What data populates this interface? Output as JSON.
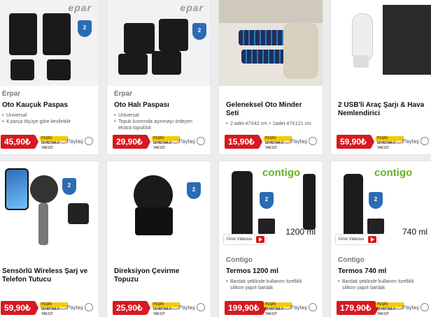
{
  "currency_note": "₺",
  "products": [
    {
      "brand_logo": "epar",
      "maker": "Erpar",
      "title": "Oto Kauçuk Paspas",
      "features": [
        "Universal",
        "4 parça ölçüye göre kesilebilir"
      ],
      "price": "45,90₺",
      "installment_top": "PEŞİN FİYATINA 6 TAKSİT",
      "installment_bottom": "bonus maximum",
      "share_label": "Paylaş",
      "guarantee": "2"
    },
    {
      "brand_logo": "epar",
      "maker": "Erpar",
      "title": "Oto Halı Paspası",
      "features": [
        "Universal",
        "Topuk kısmında aşınmayı önleyen ekstra topukluk"
      ],
      "price": "29,90₺",
      "installment_top": "PEŞİN FİYATINA 6 TAKSİT",
      "installment_bottom": "bonus maximum",
      "share_label": "Paylaş",
      "guarantee": "2"
    },
    {
      "maker": "",
      "title": "Geleneksel Oto Minder Seti",
      "features": [
        "2 adet 47X42 cm + 1adet 47X121 cm"
      ],
      "price": "15,90₺",
      "installment_top": "PEŞİN FİYATINA 6 TAKSİT",
      "installment_bottom": "bonus maximum",
      "share_label": "Paylaş"
    },
    {
      "maker": "",
      "title": "2 USB'li Araç Şarjı & Hava Nemlendirici",
      "features": [],
      "price": "59,90₺",
      "installment_top": "PEŞİN FİYATINA 6 TAKSİT",
      "installment_bottom": "bonus maximum",
      "share_label": "Paylaş"
    },
    {
      "maker": "",
      "title": "Sensörlü Wireless Şarj ve Telefon Tutucu",
      "features": [],
      "price": "59,90₺",
      "installment_top": "PEŞİN FİYATINA 6 TAKSİT",
      "installment_bottom": "bonus maximum",
      "share_label": "Paylaş",
      "guarantee": "2"
    },
    {
      "maker": "",
      "title": "Direksiyon Çevirme Topuzu",
      "features": [],
      "price": "25,90₺",
      "installment_top": "PEŞİN FİYATINA 6 TAKSİT",
      "installment_bottom": "bonus maximum",
      "share_label": "Paylaş",
      "guarantee": "2"
    },
    {
      "brand_logo": "contigo",
      "maker": "Contigo",
      "title": "Termos 1200 ml",
      "features": [
        "Bardak şeklinde kullanım özellikli silikon yapılı bardak"
      ],
      "price": "199,90₺",
      "installment_top": "PEŞİN FİYATINA 6 TAKSİT",
      "installment_bottom": "bonus maximum",
      "share_label": "Paylaş",
      "video_label": "Ürün Videosu",
      "volume": "1200 ml",
      "guarantee": "2"
    },
    {
      "brand_logo": "contigo",
      "maker": "Contigo",
      "title": "Termos 740 ml",
      "features": [
        "Bardak şeklinde kullanım özellikli silikon yapılı bardak"
      ],
      "price": "179,90₺",
      "installment_top": "PEŞİN FİYATINA 6 TAKSİT",
      "installment_bottom": "bonus maximum",
      "share_label": "Paylaş",
      "video_label": "Ürün Videosu",
      "volume": "740 ml",
      "guarantee": "2"
    }
  ]
}
